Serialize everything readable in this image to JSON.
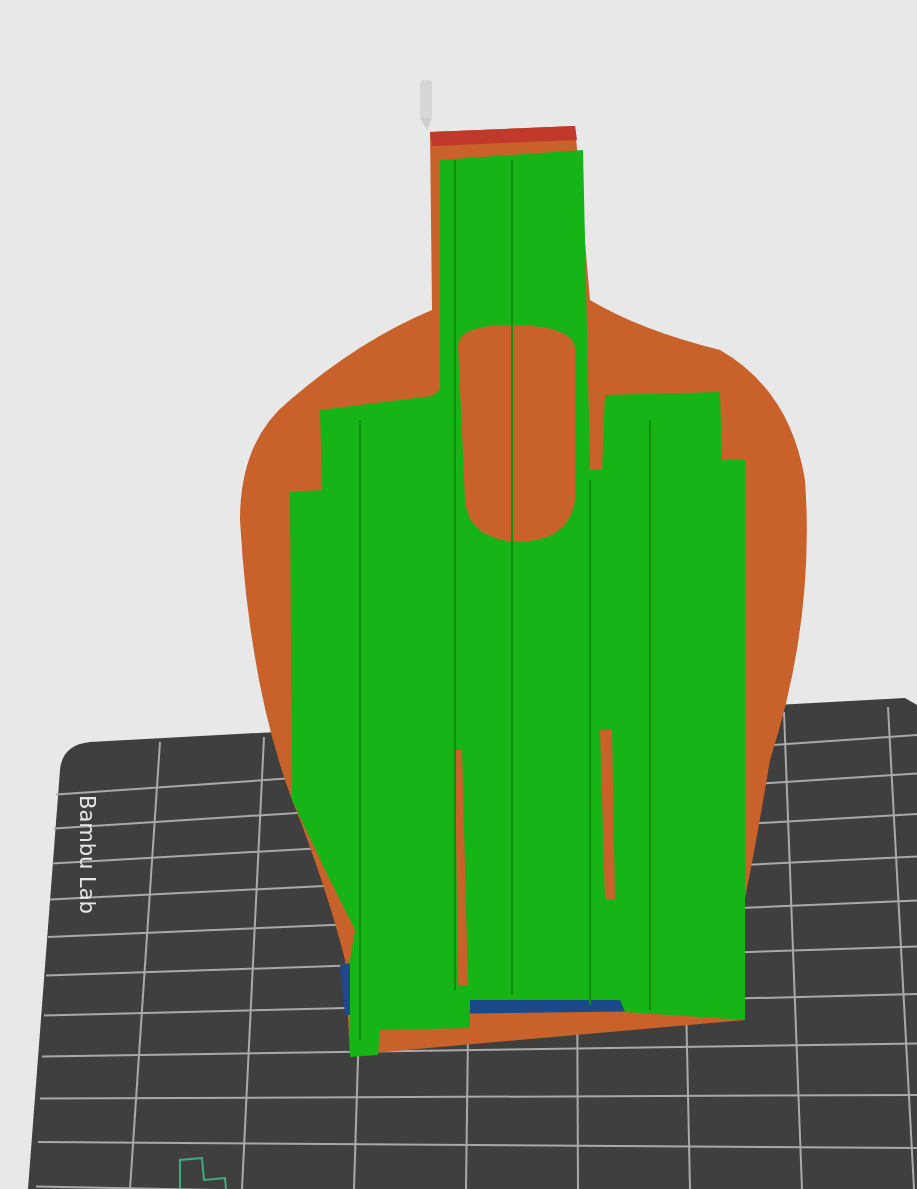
{
  "viewport": {
    "plate_label": "Bambu Lab"
  }
}
